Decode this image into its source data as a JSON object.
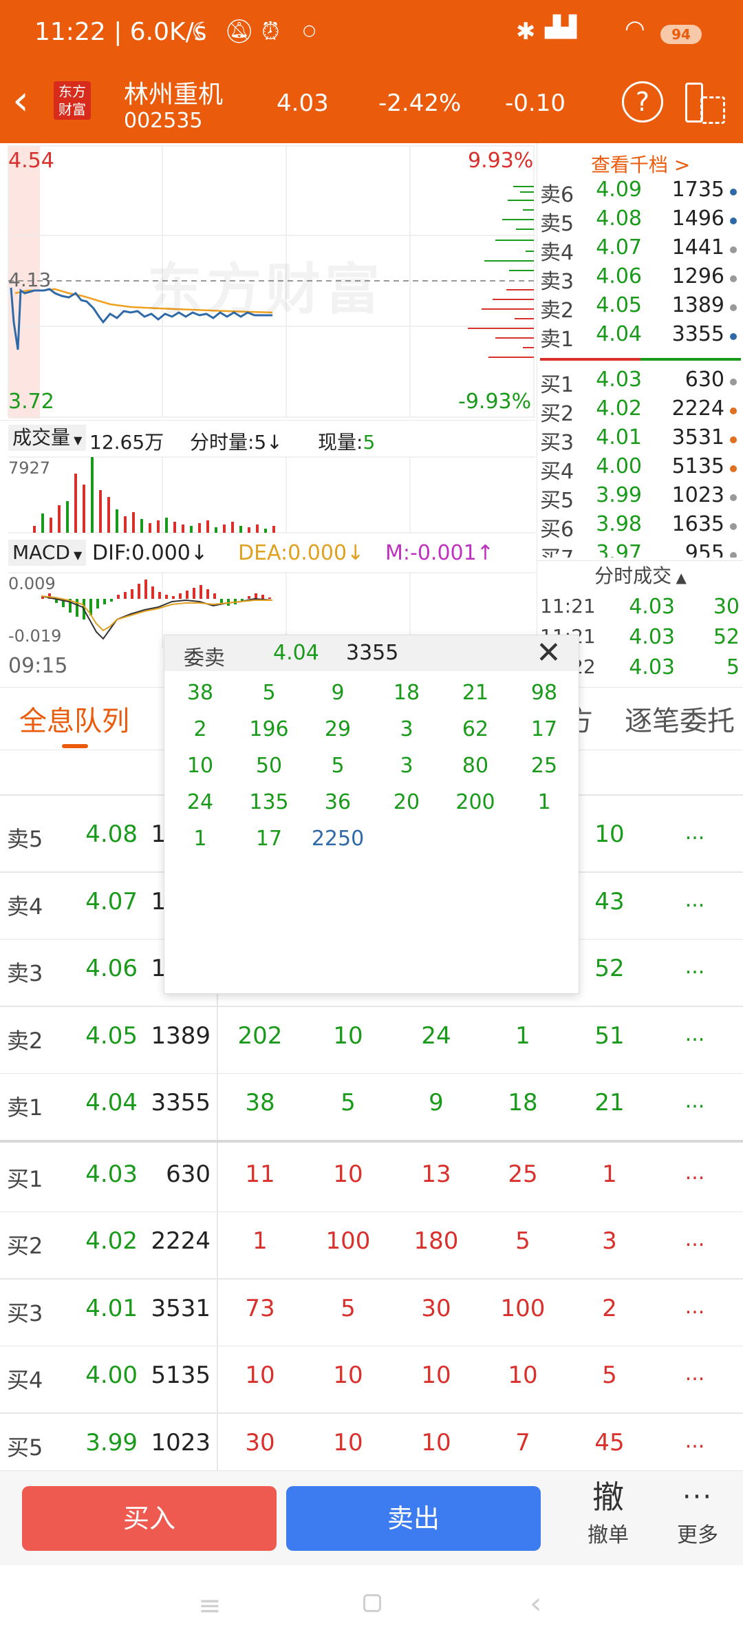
{
  "status_bar": {
    "time": "11:22",
    "net_speed": "6.0K/s",
    "battery": "94"
  },
  "header": {
    "brand": "东方财富",
    "stock_name": "林州重机",
    "stock_code": "002535",
    "price": "4.03",
    "change_pct": "-2.42%",
    "change": "-0.10"
  },
  "chart": {
    "high_price": "4.54",
    "low_price": "3.72",
    "mid_price": "4.13",
    "high_pct": "9.93%",
    "low_pct": "-9.93%",
    "watermark": "东方财富",
    "time_start": "09:15",
    "volume_label": "成交量",
    "volume_value": "12.65万",
    "fenshi_label": "分时量:5↓",
    "xianliang_label": "现量:",
    "xianliang_value": "5",
    "vol_max": "7927",
    "macd_label": "MACD",
    "dif": "DIF:0.000↓",
    "dea": "DEA:0.000↓",
    "m": "M:-0.001↑",
    "macd_high": "0.009",
    "macd_low": "-0.019"
  },
  "quote_panel": {
    "link": "查看千档 >",
    "sells": [
      {
        "label": "卖6",
        "price": "4.09",
        "vol": "1735",
        "dot": "#2f6aa8"
      },
      {
        "label": "卖5",
        "price": "4.08",
        "vol": "1496",
        "dot": "#2f6aa8"
      },
      {
        "label": "卖4",
        "price": "4.07",
        "vol": "1441",
        "dot": "#999999"
      },
      {
        "label": "卖3",
        "price": "4.06",
        "vol": "1296",
        "dot": "#999999"
      },
      {
        "label": "卖2",
        "price": "4.05",
        "vol": "1389",
        "dot": "#999999"
      },
      {
        "label": "卖1",
        "price": "4.04",
        "vol": "3355",
        "dot": "#2f6aa8"
      }
    ],
    "buys": [
      {
        "label": "买1",
        "price": "4.03",
        "vol": "630",
        "dot": "#999999"
      },
      {
        "label": "买2",
        "price": "4.02",
        "vol": "2224",
        "dot": "#e07020"
      },
      {
        "label": "买3",
        "price": "4.01",
        "vol": "3531",
        "dot": "#e07020"
      },
      {
        "label": "买4",
        "price": "4.00",
        "vol": "5135",
        "dot": "#e07020"
      },
      {
        "label": "买5",
        "price": "3.99",
        "vol": "1023",
        "dot": "#999999"
      },
      {
        "label": "买6",
        "price": "3.98",
        "vol": "1635",
        "dot": "#999999"
      },
      {
        "label": "买7",
        "price": "3.97",
        "vol": "955",
        "dot": "#999999"
      }
    ],
    "trades_title": "分时成交",
    "trades": [
      {
        "time": "11:21",
        "price": "4.03",
        "vol": "30"
      },
      {
        "time": "11:21",
        "price": "4.03",
        "vol": "52"
      },
      {
        "time": "11:22",
        "price": "4.03",
        "vol": "5"
      }
    ]
  },
  "tabs": {
    "active": "全息队列",
    "partial": "方",
    "right": "逐笔委托"
  },
  "queue_rows": [
    {
      "label": "卖5",
      "price": "4.08",
      "vol": "1496",
      "q": [
        "",
        "",
        "",
        "",
        "10"
      ],
      "side": "sell"
    },
    {
      "label": "卖4",
      "price": "4.07",
      "vol": "1441",
      "q": [
        "",
        "",
        "",
        "",
        "43"
      ],
      "side": "sell"
    },
    {
      "label": "卖3",
      "price": "4.06",
      "vol": "1296",
      "q": [
        "",
        "",
        "",
        "",
        "52"
      ],
      "side": "sell"
    },
    {
      "label": "卖2",
      "price": "4.05",
      "vol": "1389",
      "q": [
        "202",
        "10",
        "24",
        "1",
        "51"
      ],
      "side": "sell"
    },
    {
      "label": "卖1",
      "price": "4.04",
      "vol": "3355",
      "q": [
        "38",
        "5",
        "9",
        "18",
        "21"
      ],
      "side": "sell"
    },
    {
      "label": "买1",
      "price": "4.03",
      "vol": "630",
      "q": [
        "11",
        "10",
        "13",
        "25",
        "1"
      ],
      "side": "buy"
    },
    {
      "label": "买2",
      "price": "4.02",
      "vol": "2224",
      "q": [
        "1",
        "100",
        "180",
        "5",
        "3"
      ],
      "side": "buy"
    },
    {
      "label": "买3",
      "price": "4.01",
      "vol": "3531",
      "q": [
        "73",
        "5",
        "30",
        "100",
        "2"
      ],
      "side": "buy"
    },
    {
      "label": "买4",
      "price": "4.00",
      "vol": "5135",
      "q": [
        "10",
        "10",
        "10",
        "10",
        "5"
      ],
      "side": "buy"
    },
    {
      "label": "买5",
      "price": "3.99",
      "vol": "1023",
      "q": [
        "30",
        "10",
        "10",
        "7",
        "45"
      ],
      "side": "buy"
    }
  ],
  "more": "...",
  "popup": {
    "title": "委卖",
    "price": "4.04",
    "vol": "3355",
    "orders": [
      "38",
      "5",
      "9",
      "18",
      "21",
      "98",
      "2",
      "196",
      "29",
      "3",
      "62",
      "17",
      "10",
      "50",
      "5",
      "3",
      "80",
      "25",
      "24",
      "135",
      "36",
      "20",
      "200",
      "1",
      "1",
      "17",
      "2250"
    ]
  },
  "bottom_bar": {
    "buy": "买入",
    "sell": "卖出",
    "cancel_icon": "撤",
    "cancel": "撤单",
    "more_icon": "···",
    "more": "更多"
  }
}
